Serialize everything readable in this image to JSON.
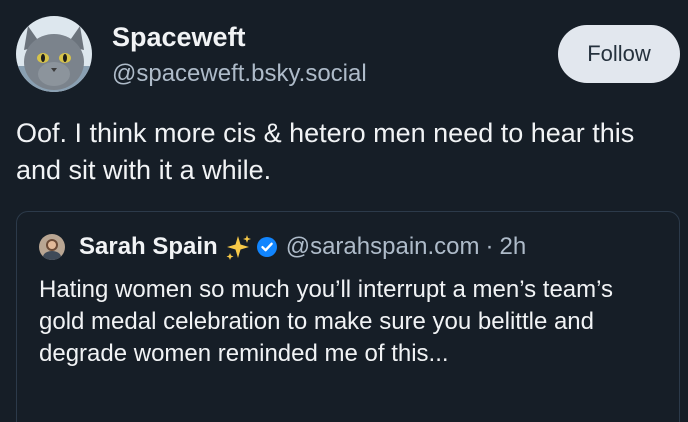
{
  "post": {
    "author": {
      "name": "Spaceweft",
      "handle": "@spaceweft.bsky.social",
      "avatar_icon": "gray-cat-avatar"
    },
    "follow_label": "Follow",
    "text": "Oof. I think more cis & hetero men need to hear this and sit with it a while."
  },
  "quote": {
    "author_name": "Sarah Spain",
    "sparkle_icon": "sparkles-icon",
    "verified_icon": "verified-badge-icon",
    "handle": "@sarahspain.com",
    "separator": "·",
    "time": "2h",
    "text": "Hating women so much you’ll interrupt a men’s team’s gold medal celebration to make sure you belittle and degrade women reminded me of this..."
  },
  "colors": {
    "background": "#161e27",
    "text_primary": "#f1f3f5",
    "text_secondary": "#aebbc9",
    "follow_bg": "#e2e7ee",
    "follow_text": "#25313d",
    "card_border": "#2c3a4a",
    "verified": "#1185fe",
    "sparkle": "#f7c948"
  }
}
